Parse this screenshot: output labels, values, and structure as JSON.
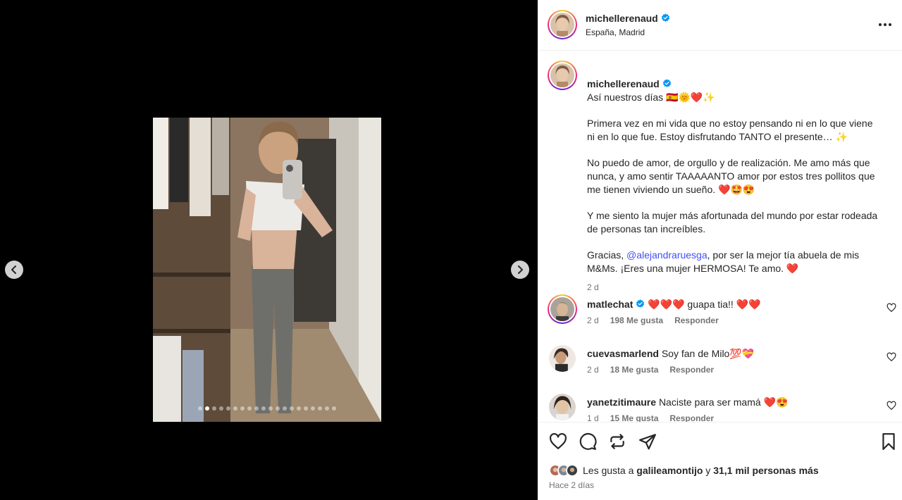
{
  "post": {
    "username": "michellerenaud",
    "verified": true,
    "location": "España, Madrid",
    "carousel": {
      "total_slides": 20,
      "active_index": 1
    }
  },
  "caption": {
    "username": "michellerenaud",
    "title": "Así nuestros días 🇪🇸🌞❤️✨",
    "paragraphs": [
      "Primera vez en mi vida que no estoy pensando ni en lo que viene ni en lo que fue. Estoy disfrutando TANTO el presente… ✨",
      "No puedo de amor, de orgullo y de realización. Me amo más que nunca, y amo sentir TAAAAANTO amor por estos tres pollitos que me tienen viviendo un sueño. ❤️🤩😍",
      "Y me siento la mujer más afortunada del mundo por estar rodeada de personas tan increíbles."
    ],
    "last_paragraph_prefix": "Gracias, ",
    "mention": "@alejandraruesga",
    "last_paragraph_suffix": ", por ser la mejor tía abuela de mis M&Ms. ¡Eres una mujer HERMOSA! Te amo. ❤️",
    "time": "2 d"
  },
  "comments": [
    {
      "username": "matlechat",
      "verified": true,
      "text": "❤️❤️❤️ guapa tia!! ❤️❤️",
      "time": "2 d",
      "likes": "198 Me gusta",
      "reply": "Responder"
    },
    {
      "username": "cuevasmarlend",
      "verified": false,
      "text": "Soy fan de Milo💯💝",
      "time": "2 d",
      "likes": "18 Me gusta",
      "reply": "Responder"
    },
    {
      "username": "yanetzitimaure",
      "verified": false,
      "text": "Naciste para ser mamá ❤️😍",
      "time": "1 d",
      "likes": "15 Me gusta",
      "reply": "Responder"
    }
  ],
  "likes": {
    "prefix": "Les gusta a ",
    "user": "galileamontijo",
    "joiner": " y ",
    "others": "31,1 mil personas más"
  },
  "post_date": "Hace 2 días",
  "icons": {
    "like": "heart-icon",
    "comment": "comment-icon",
    "share": "repost-icon",
    "send": "send-icon",
    "save": "bookmark-icon",
    "verified": "verified-badge-icon"
  },
  "colors": {
    "link": "#4150f7",
    "verified": "#0095f6",
    "secondary_text": "#737373"
  }
}
